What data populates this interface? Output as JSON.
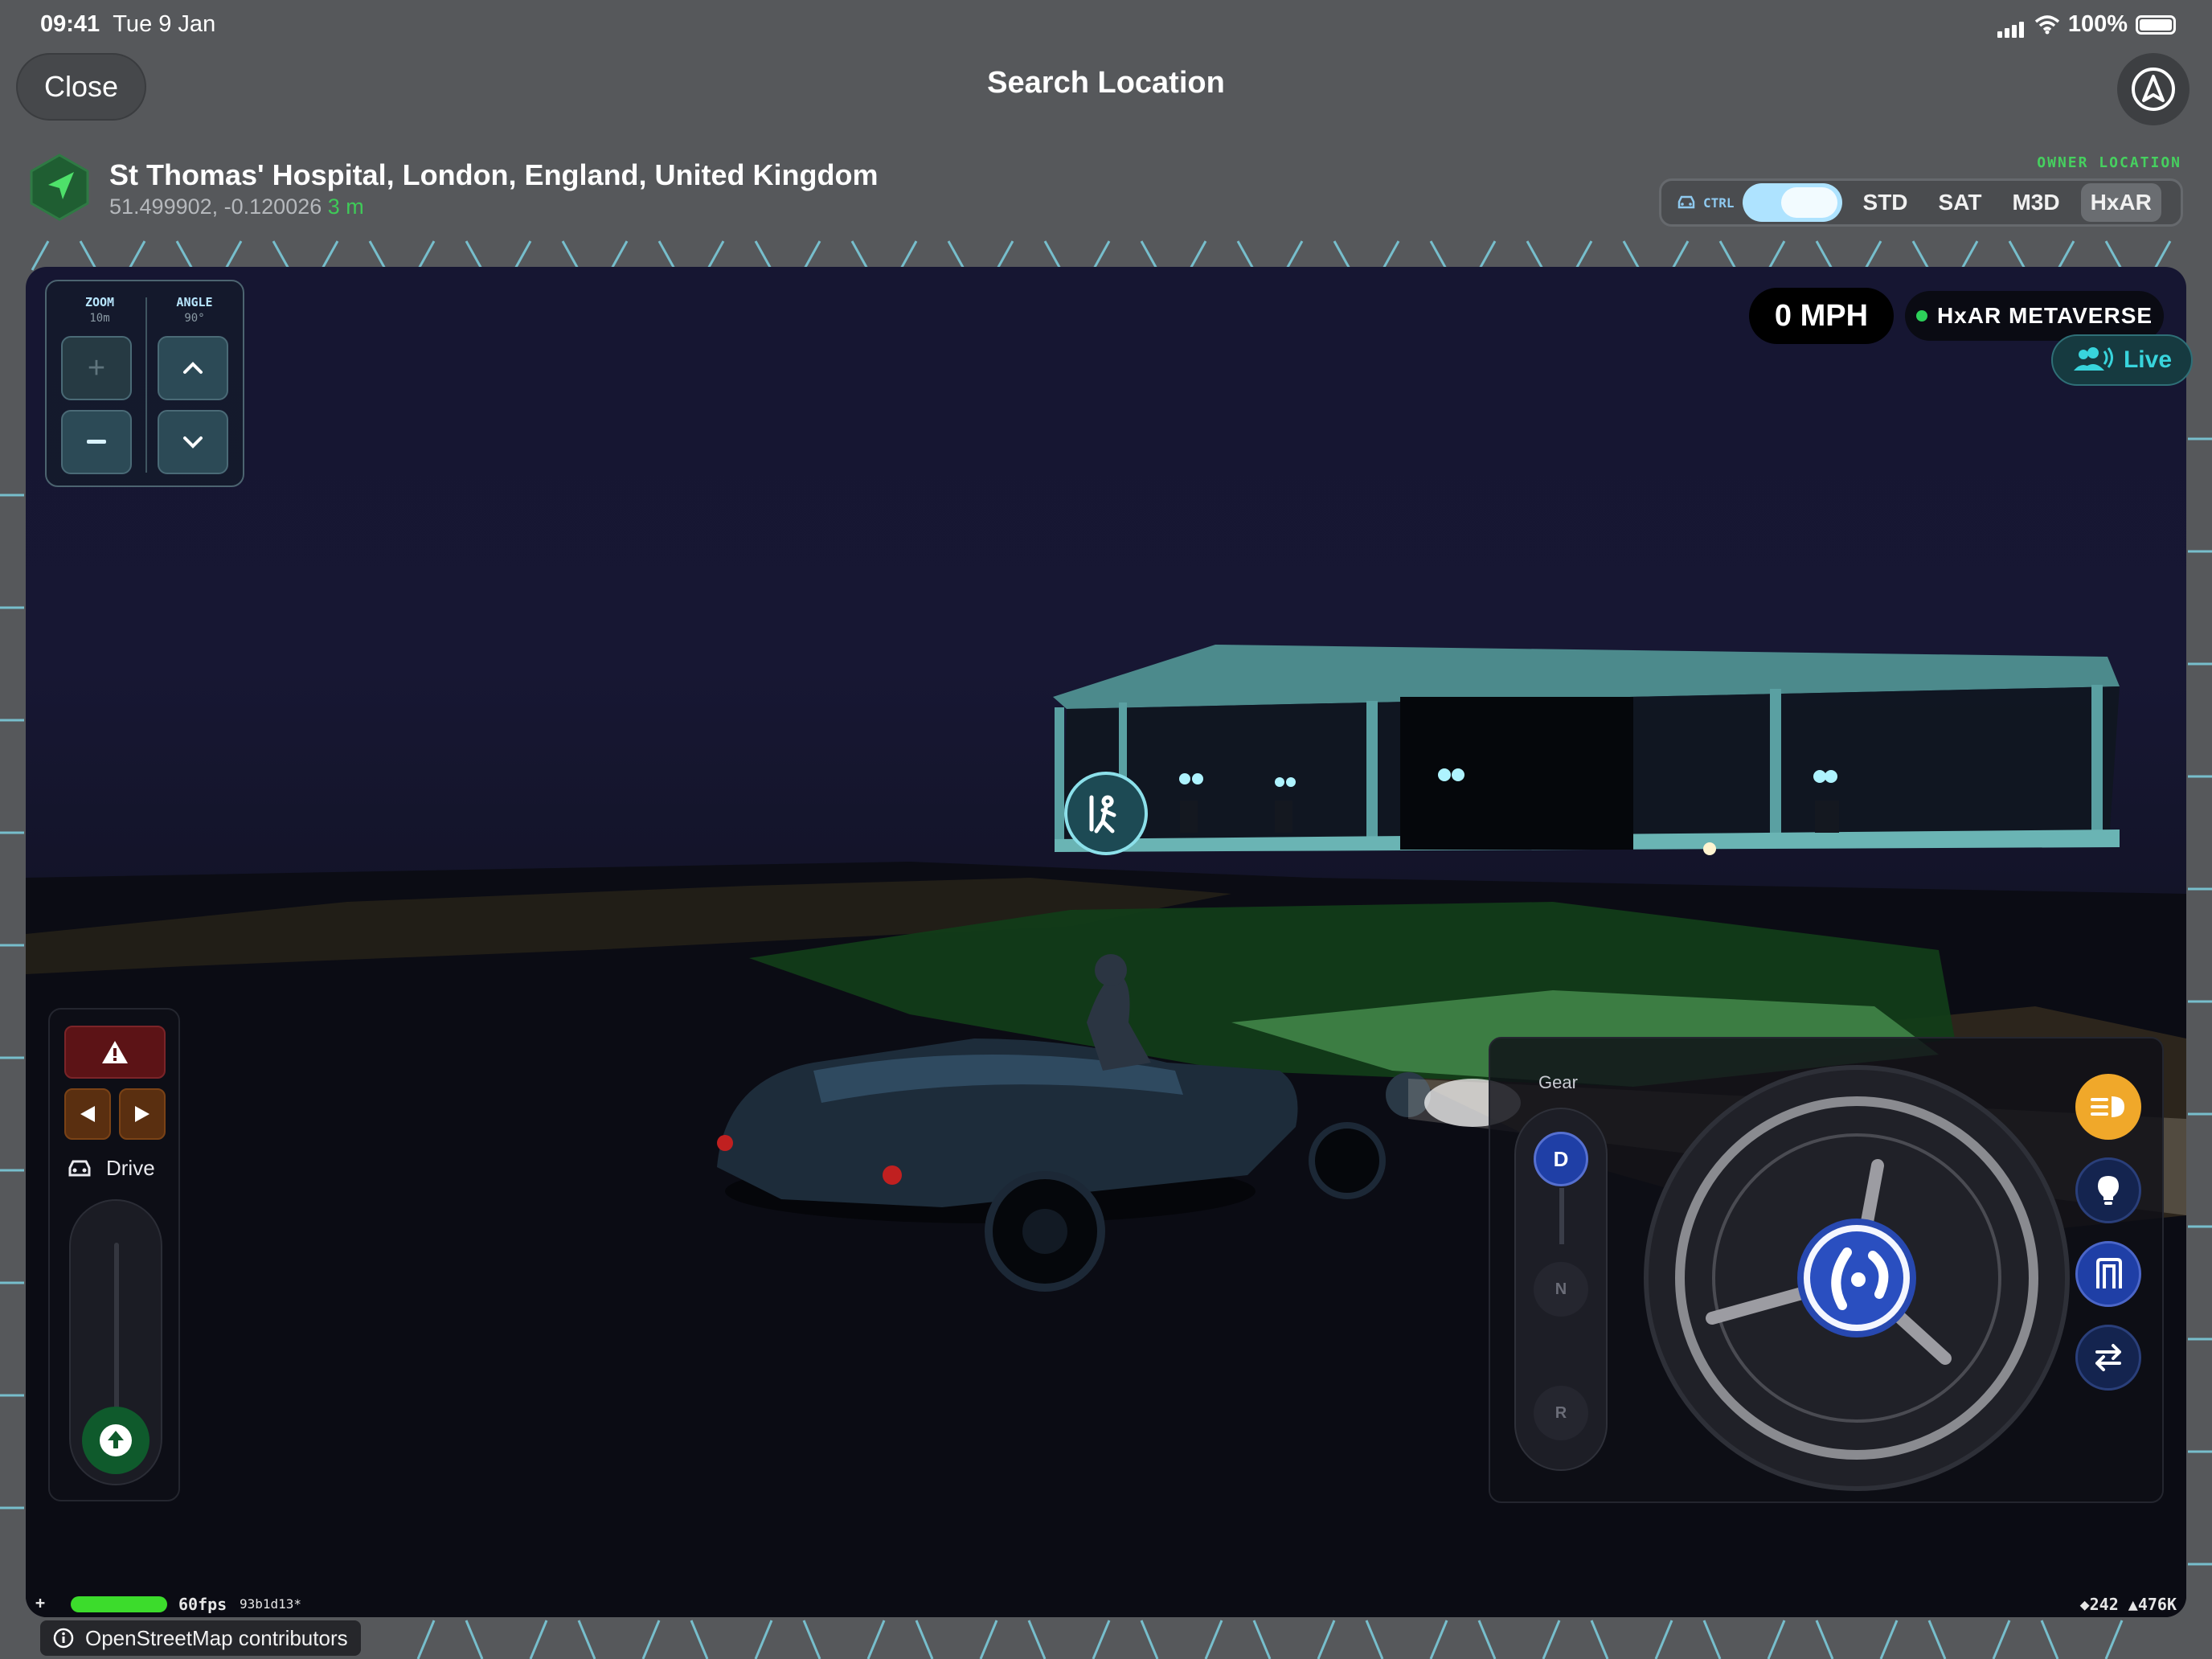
{
  "status_bar": {
    "time": "09:41",
    "date": "Tue 9 Jan",
    "battery": "100%"
  },
  "header": {
    "close_label": "Close",
    "title": "Search Location"
  },
  "location": {
    "name": "St Thomas' Hospital, London, England, United Kingdom",
    "coordinates": "51.499902, -0.120026",
    "accuracy": "3 m",
    "owner_label": "OWNER LOCATION"
  },
  "map_modes": {
    "ctrl_label": "CTRL",
    "ctrl_on": true,
    "tabs": [
      "STD",
      "SAT",
      "M3D",
      "HxAR"
    ],
    "active": "HxAR"
  },
  "camera": {
    "zoom_label": "ZOOM",
    "zoom_value": "10m",
    "angle_label": "ANGLE",
    "angle_value": "90°"
  },
  "hud": {
    "speed": "0 MPH",
    "world": "HxAR METAVERSE",
    "live": "Live"
  },
  "drive": {
    "mode_label": "Drive"
  },
  "gear": {
    "label": "Gear",
    "current": "D",
    "neutral": "N",
    "reverse": "R"
  },
  "debug": {
    "plus": "+",
    "fps": "60fps",
    "build": "93b1d13*",
    "stats": "◆242  ▲476K"
  },
  "attribution": "OpenStreetMap contributors",
  "colors": {
    "accent_green": "#3fca58",
    "headlight_button": "#f0a82a",
    "control_blue": "#1f3fa6",
    "live_cyan": "#38d4dc"
  }
}
